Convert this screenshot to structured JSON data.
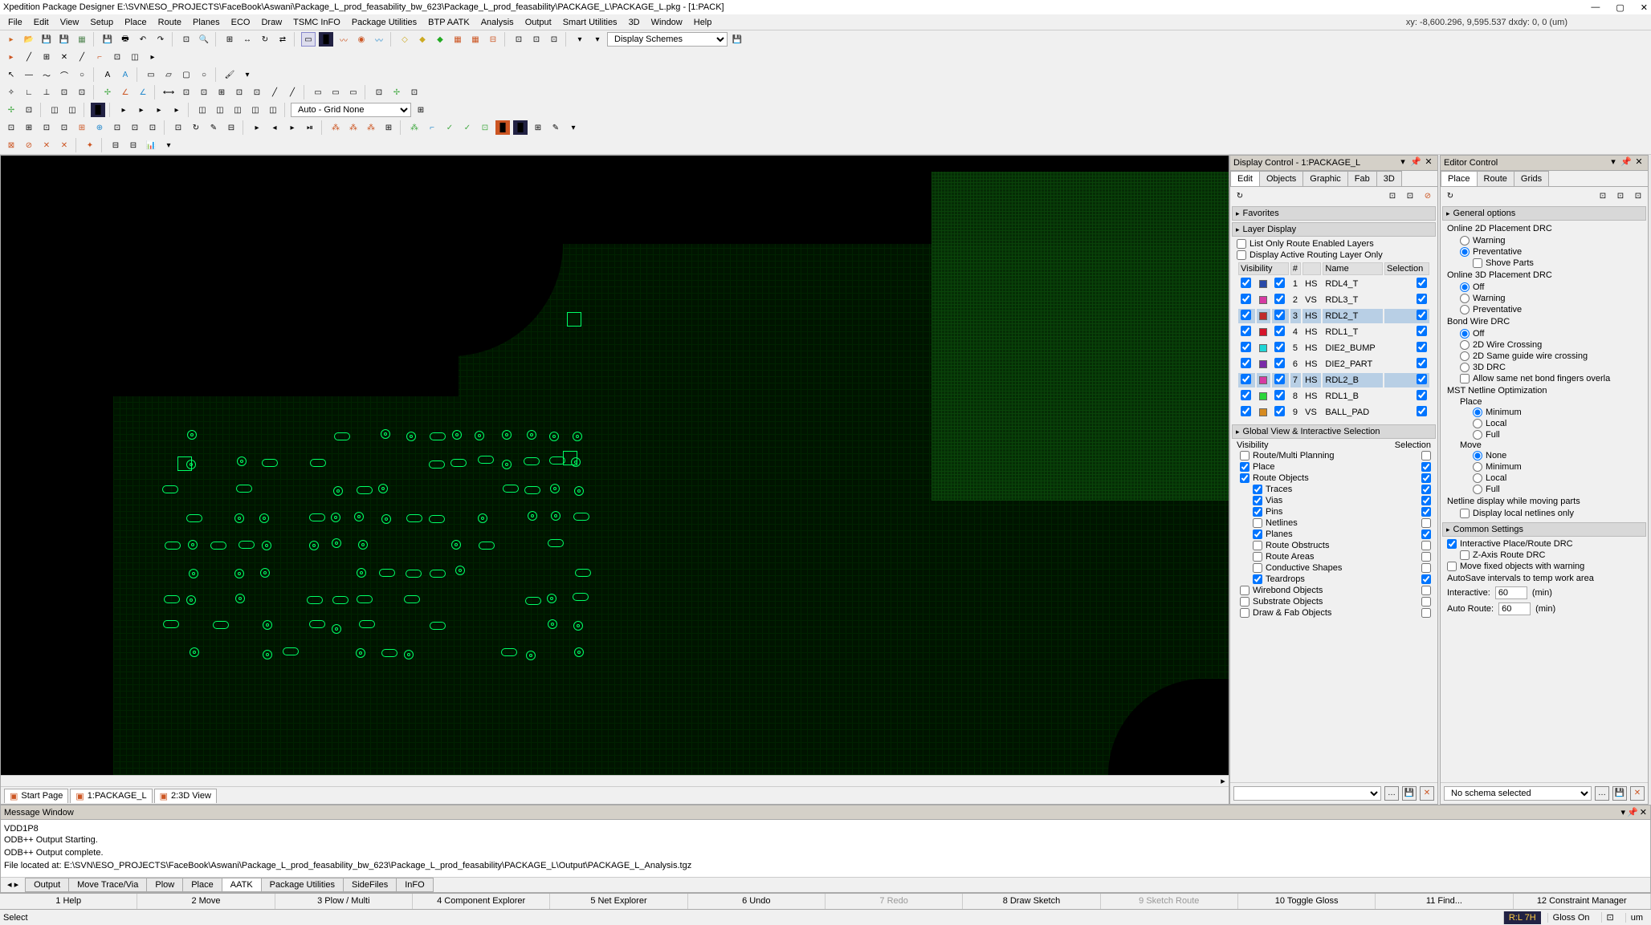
{
  "app": {
    "title": "Xpedition Package Designer  E:\\SVN\\ESO_PROJECTS\\FaceBook\\Aswani\\Package_L_prod_feasability_bw_623\\Package_L_prod_feasability\\PACKAGE_L\\PACKAGE_L.pkg  -  [1:PACK]"
  },
  "menubar": [
    "File",
    "Edit",
    "View",
    "Setup",
    "Place",
    "Route",
    "Planes",
    "ECO",
    "Draw",
    "TSMC InFO",
    "Package Utilities",
    "BTP AATK",
    "Analysis",
    "Output",
    "Smart Utilities",
    "3D",
    "Window",
    "Help"
  ],
  "coord": "xy: -8,600.296, 9,595.537   dxdy: 0, 0  (um)",
  "auto_grid": "Auto - Grid None",
  "display_schemes": "Display Schemes",
  "tabs": {
    "start": "Start Page",
    "pkg": "1:PACKAGE_L",
    "view3d": "2:3D View"
  },
  "message_window": {
    "title": "Message Window",
    "lines": [
      "VDD1P8",
      "ODB++ Output Starting.",
      "",
      "ODB++ Output complete.",
      "",
      "File located at: E:\\SVN\\ESO_PROJECTS\\FaceBook\\Aswani\\Package_L_prod_feasability_bw_623\\Package_L_prod_feasability\\PACKAGE_L\\Output\\PACKAGE_L_Analysis.tgz"
    ],
    "tabs": [
      "Output",
      "Move Trace/Via",
      "Plow",
      "Place",
      "AATK",
      "Package Utilities",
      "SideFiles",
      "InFO"
    ],
    "active_tab": "AATK"
  },
  "display_control": {
    "title": "Display Control - 1:PACKAGE_L",
    "tabs": [
      "Edit",
      "Objects",
      "Graphic",
      "Fab",
      "3D"
    ],
    "favorites": "Favorites",
    "layer_display": {
      "title": "Layer Display",
      "list_only": "List Only Route Enabled Layers",
      "display_active": "Display Active Routing Layer Only",
      "cols": {
        "vis": "Visibility",
        "num": "#",
        "name": "Name",
        "sel": "Selection"
      },
      "rows": [
        {
          "color": "#2a4aa8",
          "n": "1",
          "t": "HS",
          "name": "RDL4_T"
        },
        {
          "color": "#d63aa2",
          "n": "2",
          "t": "VS",
          "name": "RDL3_T"
        },
        {
          "color": "#c02a2a",
          "n": "3",
          "t": "HS",
          "name": "RDL2_T",
          "sel": true
        },
        {
          "color": "#d6152a",
          "n": "4",
          "t": "HS",
          "name": "RDL1_T"
        },
        {
          "color": "#1fd6d6",
          "n": "5",
          "t": "HS",
          "name": "DIE2_BUMP"
        },
        {
          "color": "#7a2aa8",
          "n": "6",
          "t": "HS",
          "name": "DIE2_PART"
        },
        {
          "color": "#d63aa2",
          "n": "7",
          "t": "HS",
          "name": "RDL2_B",
          "sel": true
        },
        {
          "color": "#2ad63a",
          "n": "8",
          "t": "HS",
          "name": "RDL1_B"
        },
        {
          "color": "#d68a1f",
          "n": "9",
          "t": "VS",
          "name": "BALL_PAD"
        }
      ]
    },
    "global_view": {
      "title": "Global View & Interactive Selection",
      "vis": "Visibility",
      "sel": "Selection",
      "items": [
        {
          "l": "Route/Multi Planning",
          "c": false
        },
        {
          "l": "Place",
          "c": true
        },
        {
          "l": "Route Objects",
          "c": true
        },
        {
          "l": "Traces",
          "c": true,
          "i": 1
        },
        {
          "l": "Vias",
          "c": true,
          "i": 1
        },
        {
          "l": "Pins",
          "c": true,
          "i": 1
        },
        {
          "l": "Netlines",
          "c": false,
          "i": 1
        },
        {
          "l": "Planes",
          "c": true,
          "i": 1
        },
        {
          "l": "Route Obstructs",
          "c": false,
          "i": 1
        },
        {
          "l": "Route Areas",
          "c": false,
          "i": 1
        },
        {
          "l": "Conductive Shapes",
          "c": false,
          "i": 1
        },
        {
          "l": "Teardrops",
          "c": true,
          "i": 1
        },
        {
          "l": "Wirebond Objects",
          "c": false
        },
        {
          "l": "Substrate Objects",
          "c": false
        },
        {
          "l": "Draw & Fab Objects",
          "c": false
        }
      ]
    }
  },
  "editor_control": {
    "title": "Editor Control",
    "tabs": [
      "Place",
      "Route",
      "Grids"
    ],
    "general": {
      "title": "General options",
      "online2d": "Online 2D Placement DRC",
      "warning": "Warning",
      "preventative": "Preventative",
      "shove": "Shove Parts",
      "online3d": "Online 3D Placement DRC",
      "off": "Off",
      "bondwire": "Bond Wire DRC",
      "crossing2d": "2D Wire Crossing",
      "sameguide": "2D Same guide wire crossing",
      "drc3d": "3D DRC",
      "allow_bond": "Allow same net bond fingers overla",
      "mst": "MST Netline Optimization",
      "place_h": "Place",
      "minimum": "Minimum",
      "local": "Local",
      "full": "Full",
      "move_h": "Move",
      "none": "None",
      "netline_moving": "Netline display while moving parts",
      "local_only": "Display local netlines only"
    },
    "common": {
      "title": "Common Settings",
      "ipr": "Interactive Place/Route DRC",
      "zaxis": "Z-Axis Route DRC",
      "movefixed": "Move fixed objects with warning",
      "autosave": "AutoSave intervals to temp work area",
      "interactive": "Interactive:",
      "autoroute": "Auto Route:",
      "intval": "60",
      "arval": "60",
      "unit": "(min)"
    },
    "no_schema": "No schema selected"
  },
  "fnbar": [
    {
      "l": "1 Help"
    },
    {
      "l": "2 Move"
    },
    {
      "l": "3 Plow / Multi"
    },
    {
      "l": "4 Component Explorer"
    },
    {
      "l": "5 Net Explorer"
    },
    {
      "l": "6 Undo"
    },
    {
      "l": "7 Redo",
      "dis": true
    },
    {
      "l": "8 Draw Sketch"
    },
    {
      "l": "9 Sketch Route",
      "dis": true
    },
    {
      "l": "10 Toggle Gloss"
    },
    {
      "l": "11 Find..."
    },
    {
      "l": "12 Constraint Manager"
    }
  ],
  "status": {
    "left": "Select",
    "rl": "R:L 7H",
    "gloss": "Gloss On",
    "um": "um"
  }
}
